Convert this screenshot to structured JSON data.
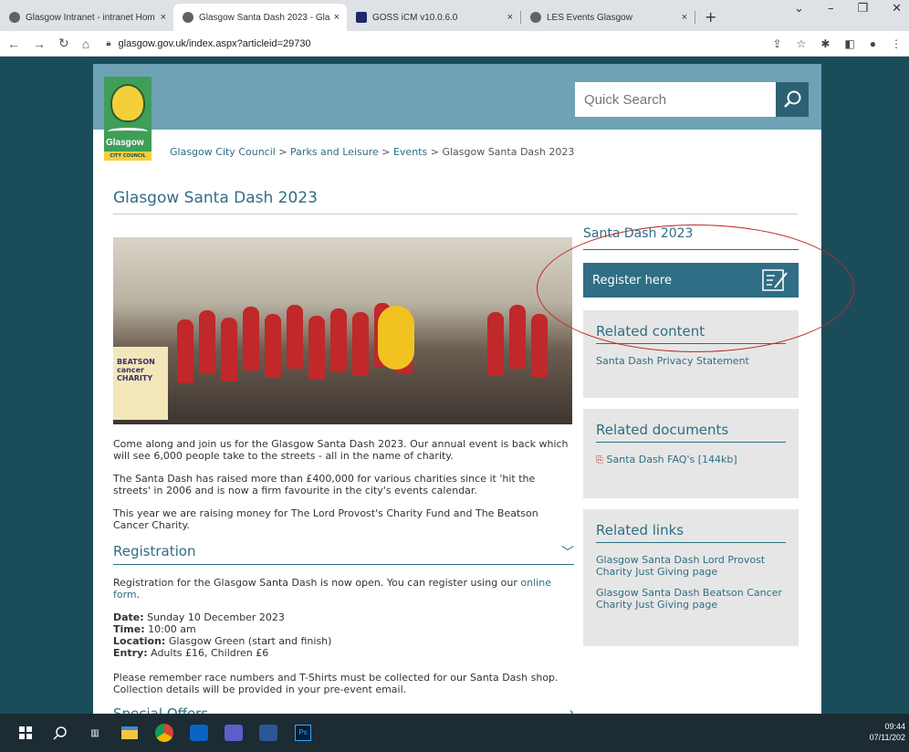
{
  "browser": {
    "tabs": [
      {
        "title": "Glasgow Intranet - intranet Hom",
        "close": "×"
      },
      {
        "title": "Glasgow Santa Dash 2023 - Glas",
        "close": "×"
      },
      {
        "title": "GOSS iCM v10.0.6.0",
        "close": "×"
      },
      {
        "title": "LES Events Glasgow",
        "close": "×"
      }
    ],
    "new_tab": "+",
    "url": "glasgow.gov.uk/index.aspx?articleid=29730"
  },
  "header": {
    "logo_text": "Glasgow",
    "logo_subtext": "CITY COUNCIL",
    "search_placeholder": "Quick Search"
  },
  "breadcrumb": {
    "items": [
      "Glasgow City Council",
      "Parks and Leisure",
      "Events"
    ],
    "current": "Glasgow Santa Dash 2023",
    "separator": ">"
  },
  "main": {
    "title": "Glasgow Santa Dash 2023",
    "hero_caption": "BEATSON cancer CHARITY",
    "paragraphs": [
      "Come along and join us for the Glasgow Santa Dash 2023. Our annual event is back which will see 6,000 people take to the streets - all in the name of charity.",
      "The Santa Dash has raised more than £400,000 for various charities since it 'hit the streets' in 2006 and is now a firm favourite in the city's events calendar.",
      "This year we are raising money for The Lord Provost's Charity Fund and The Beatson Cancer Charity."
    ],
    "registration": {
      "heading": "Registration",
      "intro": "Registration for the Glasgow Santa Dash is now open. You can register using our",
      "link": "online form",
      "date_label": "Date:",
      "date": "Sunday 10 December 2023",
      "time_label": "Time:",
      "time": "10:00 am",
      "location_label": "Location:",
      "location": "Glasgow Green (start and finish)",
      "entry_label": "Entry:",
      "entry": "Adults £16, Children £6",
      "note": "Please remember race numbers and T-Shirts must be collected for our Santa Dash shop. Collection details will be provided in your pre-event email."
    },
    "next_section": "Special Offers"
  },
  "sidebar": {
    "title": "Santa Dash 2023",
    "register_label": "Register here",
    "related_content": {
      "heading": "Related content",
      "links": [
        "Santa Dash Privacy Statement"
      ]
    },
    "related_documents": {
      "heading": "Related documents",
      "links": [
        "Santa Dash FAQ's [144kb]"
      ]
    },
    "related_links": {
      "heading": "Related links",
      "links": [
        "Glasgow Santa Dash Lord Provost Charity Just Giving page",
        "Glasgow Santa Dash Beatson Cancer Charity Just Giving page"
      ]
    }
  },
  "taskbar": {
    "time": "09:44",
    "date": "07/11/202"
  },
  "colors": {
    "accent": "#2f6e84",
    "header_band": "#6fa2b4",
    "annotation": "#c0282a"
  }
}
